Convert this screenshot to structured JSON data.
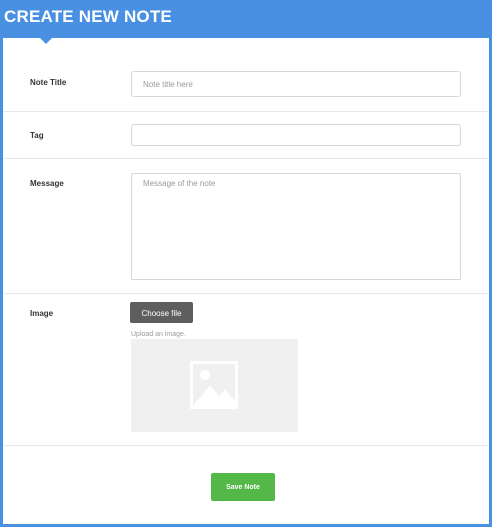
{
  "header": {
    "title": "CREATE NEW NOTE"
  },
  "form": {
    "note_title": {
      "label": "Note Title",
      "placeholder": "Note title here",
      "value": ""
    },
    "tag": {
      "label": "Tag",
      "placeholder": "",
      "value": ""
    },
    "message": {
      "label": "Message",
      "placeholder": "Message of the note",
      "value": ""
    },
    "image": {
      "label": "Image",
      "choose_file_label": "Choose file",
      "help_text": "Upload an image."
    },
    "save_label": "Save Note"
  },
  "colors": {
    "accent": "#4a90e2",
    "save_button": "#53b848",
    "choose_file_button": "#5e5e5e"
  },
  "icons": {
    "image_placeholder": "image-placeholder-icon"
  }
}
